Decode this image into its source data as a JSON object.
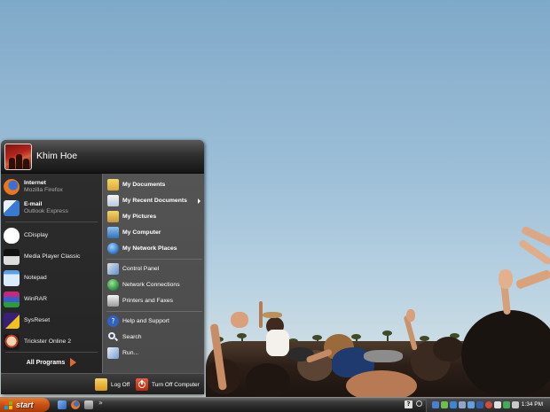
{
  "user": {
    "name": "Khim Hoe"
  },
  "pinned": [
    {
      "id": "internet",
      "title": "Internet",
      "subtitle": "Mozilla Firefox",
      "icon": "firefox-icon"
    },
    {
      "id": "email",
      "title": "E-mail",
      "subtitle": "Outlook Express",
      "icon": "outlook-express-icon"
    }
  ],
  "recent_programs": [
    {
      "label": "CDisplay",
      "icon": "cdisplay-icon"
    },
    {
      "label": "Media Player Classic",
      "icon": "media-player-classic-icon"
    },
    {
      "label": "Notepad",
      "icon": "notepad-icon"
    },
    {
      "label": "WinRAR",
      "icon": "winrar-icon"
    },
    {
      "label": "SysReset",
      "icon": "sysreset-icon"
    },
    {
      "label": "Trickster Online 2",
      "icon": "trickster-icon"
    }
  ],
  "all_programs_label": "All Programs",
  "places": [
    {
      "label": "My Documents",
      "icon": "my-documents-icon"
    },
    {
      "label": "My Recent Documents",
      "icon": "my-recent-documents-icon",
      "submenu": true
    },
    {
      "label": "My Pictures",
      "icon": "my-pictures-icon"
    },
    {
      "label": "My Computer",
      "icon": "my-computer-icon"
    },
    {
      "label": "My Network Places",
      "icon": "my-network-places-icon"
    }
  ],
  "settings": [
    {
      "label": "Control Panel",
      "icon": "control-panel-icon"
    },
    {
      "label": "Network Connections",
      "icon": "network-connections-icon"
    },
    {
      "label": "Printers and Faxes",
      "icon": "printers-faxes-icon"
    }
  ],
  "tools": [
    {
      "label": "Help and Support",
      "icon": "help-icon"
    },
    {
      "label": "Search",
      "icon": "search-icon"
    },
    {
      "label": "Run...",
      "icon": "run-icon"
    }
  ],
  "footer": {
    "log_off": "Log Off",
    "turn_off": "Turn Off Computer"
  },
  "taskbar": {
    "start_label": "start",
    "chevron": "»",
    "help_glyph": "?",
    "clock": "1:34 PM"
  },
  "colors": {
    "accent": "#e36a2a",
    "start_button": "#c84f12",
    "menu_dark": "#242424",
    "menu_right": "#4d4d4d"
  }
}
